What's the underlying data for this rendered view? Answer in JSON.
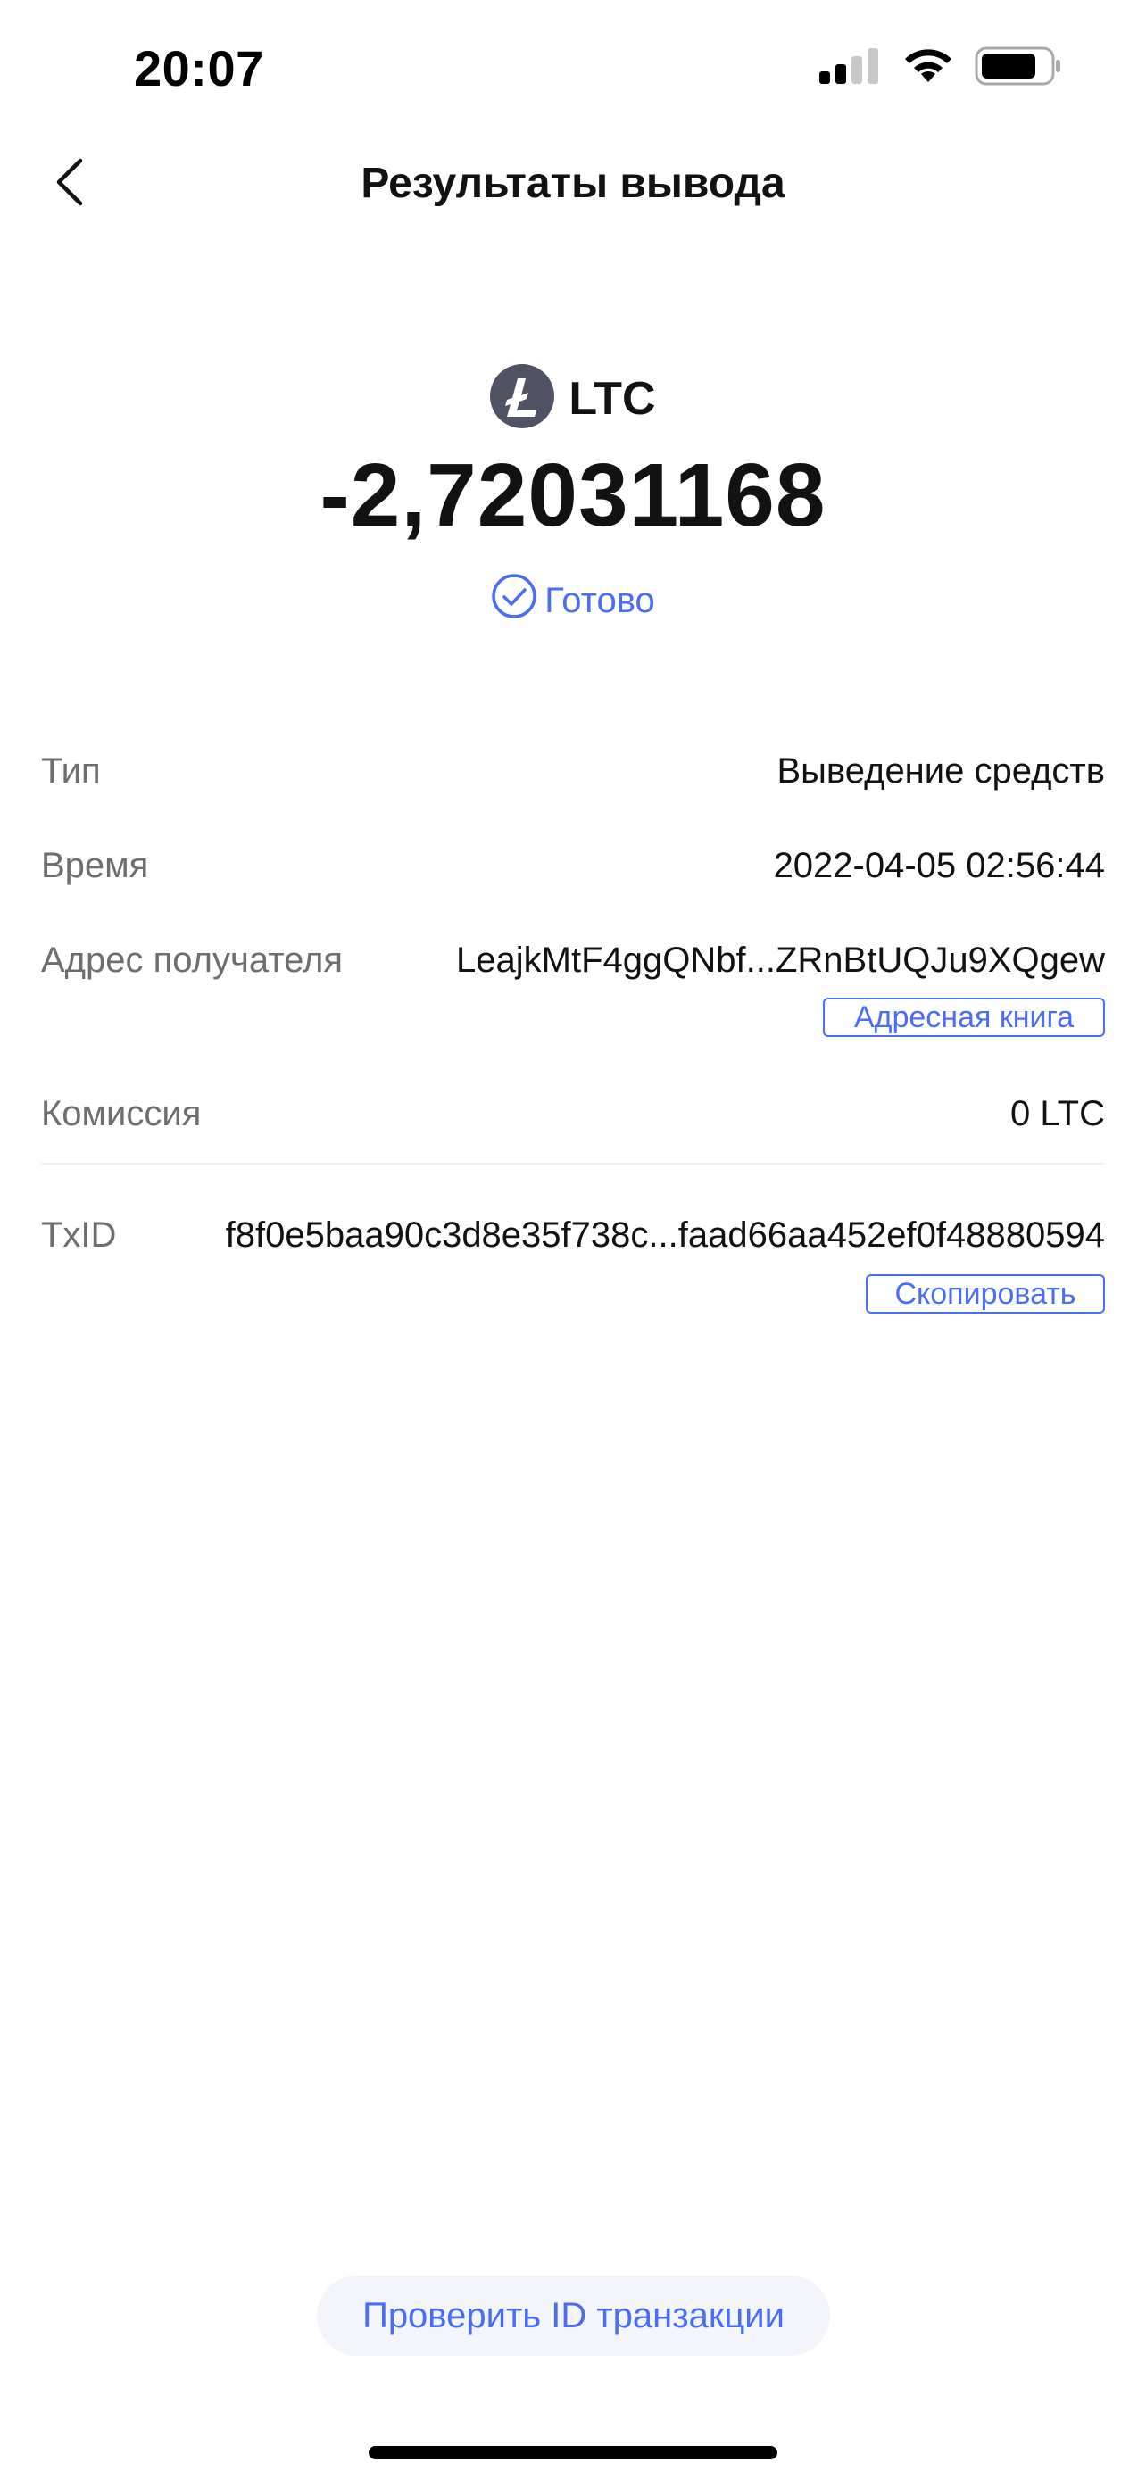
{
  "status_bar": {
    "time": "20:07",
    "icons": [
      "cellular-signal-icon",
      "wifi-icon",
      "battery-icon"
    ]
  },
  "header": {
    "back_icon": "chevron-left-icon",
    "title": "Результаты вывода"
  },
  "summary": {
    "coin_icon": "litecoin-icon",
    "coin_symbol": "LTC",
    "amount": "-2,72031168",
    "status_icon": "check-circle-icon",
    "status": "Готово"
  },
  "details": {
    "type": {
      "label": "Тип",
      "value": "Выведение средств"
    },
    "time": {
      "label": "Время",
      "value": "2022-04-05 02:56:44"
    },
    "recipient": {
      "label": "Адрес получателя",
      "value": "LeajkMtF4ggQNbf...ZRnBtUQJu9XQgew",
      "action": "Адресная книга"
    },
    "fee": {
      "label": "Комиссия",
      "value": "0 LTC"
    },
    "txid": {
      "label": "TxID",
      "value": "f8f0e5baa90c3d8e35f738c...faad66aa452ef0f48880594",
      "action": "Скопировать"
    }
  },
  "bottom_button": {
    "label": "Проверить ID транзакции"
  },
  "colors": {
    "accent": "#4a6cf7",
    "text_primary": "#121212",
    "text_secondary": "#6e6e6e",
    "coin_icon_bg": "#4f5363"
  }
}
